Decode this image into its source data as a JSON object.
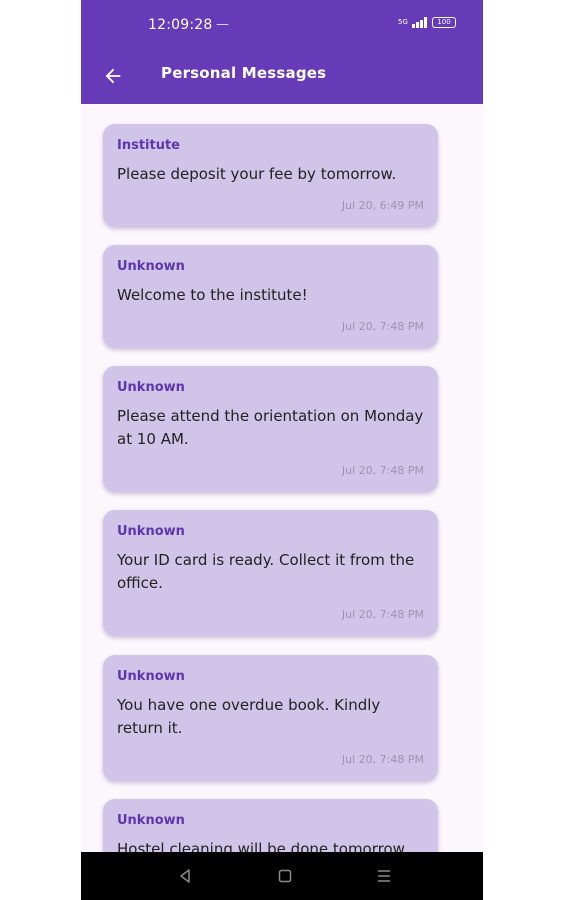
{
  "status_bar": {
    "time": "12:09:28",
    "dash": "—",
    "network_label": "5G",
    "battery": "100"
  },
  "header": {
    "title": "Personal Messages",
    "back_icon": "arrow-left-icon"
  },
  "messages": [
    {
      "sender": "Institute",
      "text": "Please deposit your fee by tomorrow.",
      "time": "Jul 20, 6:49 PM"
    },
    {
      "sender": "Unknown",
      "text": "Welcome to the institute!",
      "time": "Jul 20, 7:48 PM"
    },
    {
      "sender": "Unknown",
      "text": "Please attend the orientation on Monday at 10 AM.",
      "time": "Jul 20, 7:48 PM"
    },
    {
      "sender": "Unknown",
      "text": "Your ID card is ready. Collect it from the office.",
      "time": "Jul 20, 7:48 PM"
    },
    {
      "sender": "Unknown",
      "text": "You have one overdue book. Kindly return it.",
      "time": "Jul 20, 7:48 PM"
    },
    {
      "sender": "Unknown",
      "text": "Hostel cleaning will be done tomorrow",
      "time": ""
    }
  ],
  "nav_bar": {
    "back_icon": "triangle-back-icon",
    "home_icon": "square-home-icon",
    "menu_icon": "menu-lines-icon"
  },
  "colors": {
    "appbar": "#673ab7",
    "background": "#fcf6fd",
    "card": "#d0c4e8",
    "sender": "#5e35b1",
    "timestamp": "#9d94ad"
  }
}
